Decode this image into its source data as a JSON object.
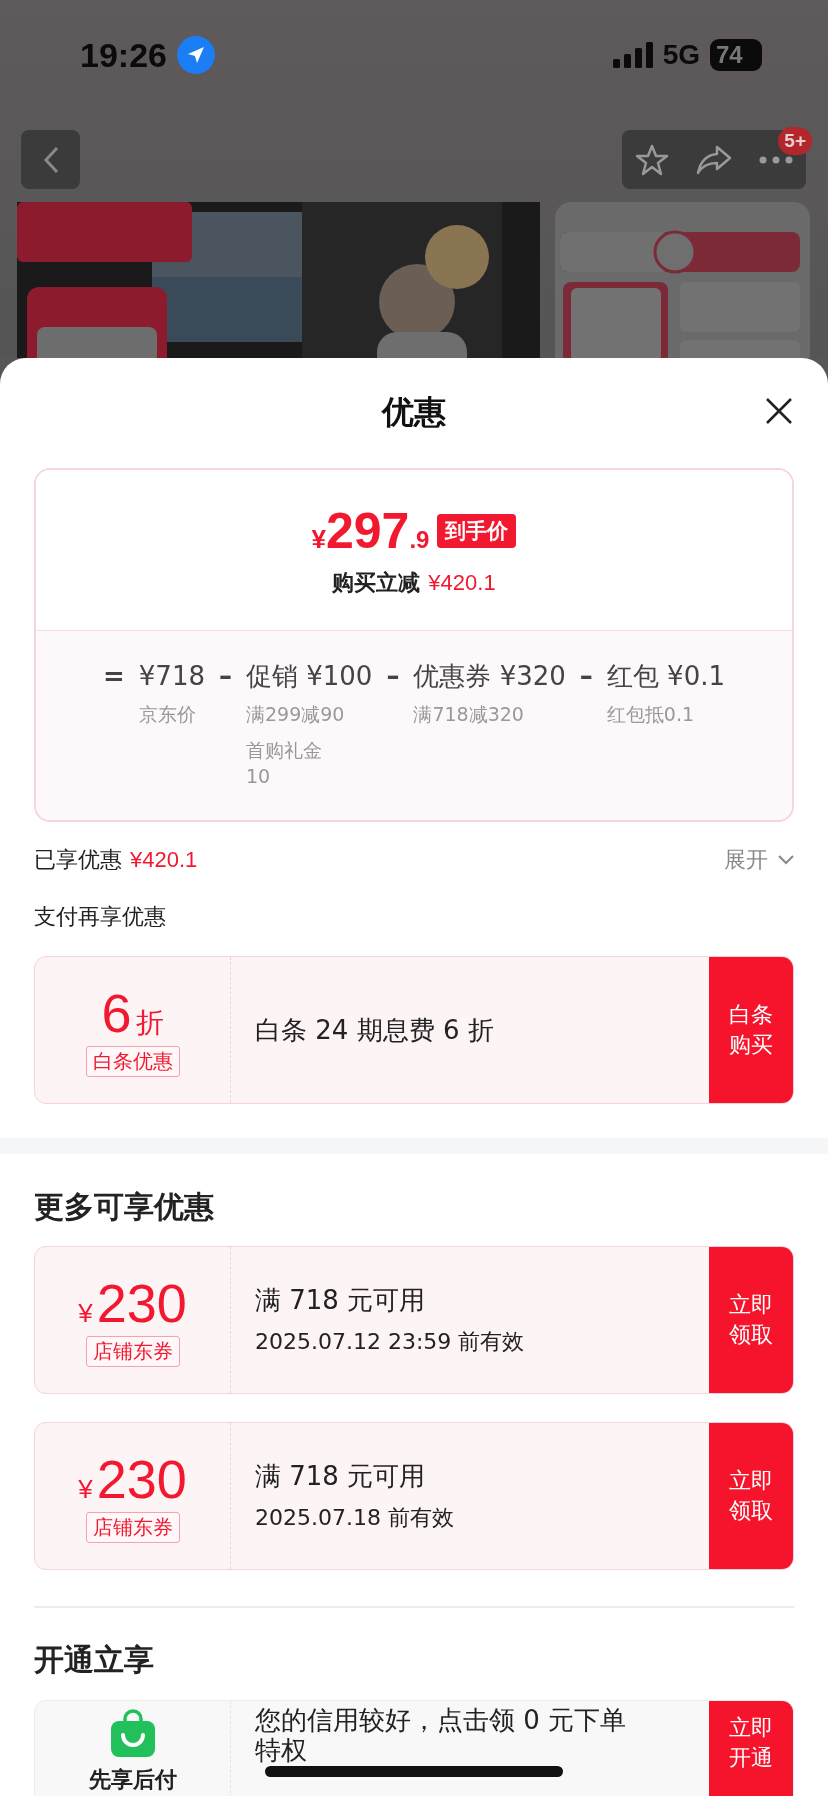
{
  "status_bar": {
    "time": "19:26",
    "network": "5G",
    "battery": "74"
  },
  "nav": {
    "badge": "5+"
  },
  "sheet": {
    "title": "优惠",
    "price_card": {
      "currency": "¥",
      "integer": "297",
      "decimal": ".9",
      "tag": "到手价",
      "saving_label": "购买立减",
      "saving_value": "¥420.1",
      "terms": [
        {
          "operator": "=",
          "amount": "¥718",
          "notes": [
            "京东价"
          ]
        },
        {
          "operator": "–",
          "label": "促销",
          "amount": "¥100",
          "notes": [
            "满299减90",
            "首购礼金 10"
          ]
        },
        {
          "operator": "–",
          "label": "优惠券",
          "amount": "¥320",
          "notes": [
            "满718减320"
          ]
        },
        {
          "operator": "–",
          "label": "红包",
          "amount": "¥0.1",
          "notes": [
            "红包抵0.1"
          ]
        }
      ]
    },
    "summary": {
      "label": "已享优惠",
      "value": "¥420.1",
      "toggle": "展开",
      "expanded": false
    },
    "sections": [
      {
        "title": "支付再享优惠",
        "offers": [
          {
            "kind": "discount",
            "big": "6",
            "unit": "折",
            "tag": "白条优惠",
            "lines": [
              "白条 24 期息费 6 折"
            ],
            "action": "白条购买"
          }
        ]
      },
      {
        "title": "更多可享优惠",
        "offers": [
          {
            "kind": "coupon",
            "currency": "¥",
            "big": "230",
            "tag": "店铺东券",
            "lines": [
              "满 718 元可用",
              "2025.07.12 23:59 前有效"
            ],
            "action": "立即领取"
          },
          {
            "kind": "coupon",
            "currency": "¥",
            "big": "230",
            "tag": "店铺东券",
            "lines": [
              "满 718 元可用",
              "2025.07.18 前有效"
            ],
            "action": "立即领取"
          }
        ]
      },
      {
        "title": "开通立享",
        "offers": [
          {
            "kind": "service",
            "name": "先享后付",
            "lines": [
              "您的信用较好，点击领 0 元下单特权"
            ],
            "action": "立即开通"
          }
        ]
      }
    ]
  }
}
